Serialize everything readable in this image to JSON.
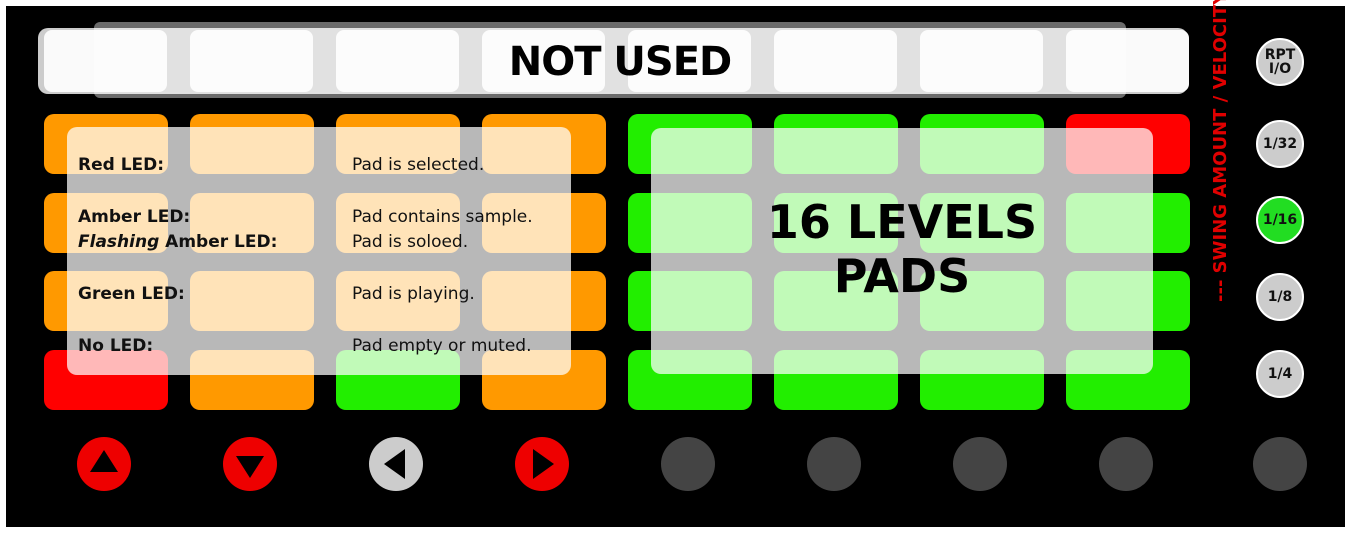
{
  "top_row": {
    "label": "NOT USED"
  },
  "legend": {
    "items": [
      {
        "led_prefix": "",
        "led": "Red LED:",
        "description": "Pad is selected."
      },
      {
        "led_prefix": "",
        "led": "Amber LED:",
        "description": "Pad contains sample."
      },
      {
        "led_prefix": "Flashing",
        "led": "Amber LED:",
        "description": "Pad is soloed."
      },
      {
        "led_prefix": "",
        "led": "Green LED:",
        "description": "Pad is playing."
      },
      {
        "led_prefix": "",
        "led": "No LED:",
        "description": "Pad empty or muted."
      }
    ]
  },
  "levels": {
    "line1": "16 LEVELS",
    "line2": "PADS"
  },
  "side": {
    "vertical_label": "--- SWING AMOUNT / VELOCITY---",
    "buttons": [
      {
        "line1": "RPT",
        "line2": "I/O"
      },
      {
        "line1": "1/32",
        "line2": ""
      },
      {
        "line1": "1/16",
        "line2": ""
      },
      {
        "line1": "1/8",
        "line2": ""
      },
      {
        "line1": "1/4",
        "line2": ""
      }
    ],
    "active_index": 2
  },
  "nav": [
    {
      "icon": "arrow-up-icon",
      "color": "#ee0000"
    },
    {
      "icon": "arrow-down-icon",
      "color": "#ee0000"
    },
    {
      "icon": "arrow-left-icon",
      "color": "#cccccc"
    },
    {
      "icon": "arrow-right-icon",
      "color": "#ee0000"
    },
    {
      "icon": "blank-button",
      "color": "#444444"
    },
    {
      "icon": "blank-button",
      "color": "#444444"
    },
    {
      "icon": "blank-button",
      "color": "#444444"
    },
    {
      "icon": "blank-button",
      "color": "#444444"
    },
    {
      "icon": "blank-button",
      "color": "#444444"
    }
  ],
  "pad_colors": {
    "red": "#ff0000",
    "amber": "#ff9900",
    "green": "#22ee00",
    "off": "#000000"
  },
  "pads": [
    [
      "amber",
      "amber",
      "amber",
      "amber",
      "green",
      "green",
      "green",
      "red"
    ],
    [
      "amber",
      "amber",
      "amber",
      "amber",
      "green",
      "green",
      "green",
      "green"
    ],
    [
      "amber",
      "amber",
      "amber",
      "amber",
      "green",
      "green",
      "green",
      "green"
    ],
    [
      "red",
      "amber",
      "green",
      "amber",
      "green",
      "green",
      "green",
      "green"
    ]
  ]
}
